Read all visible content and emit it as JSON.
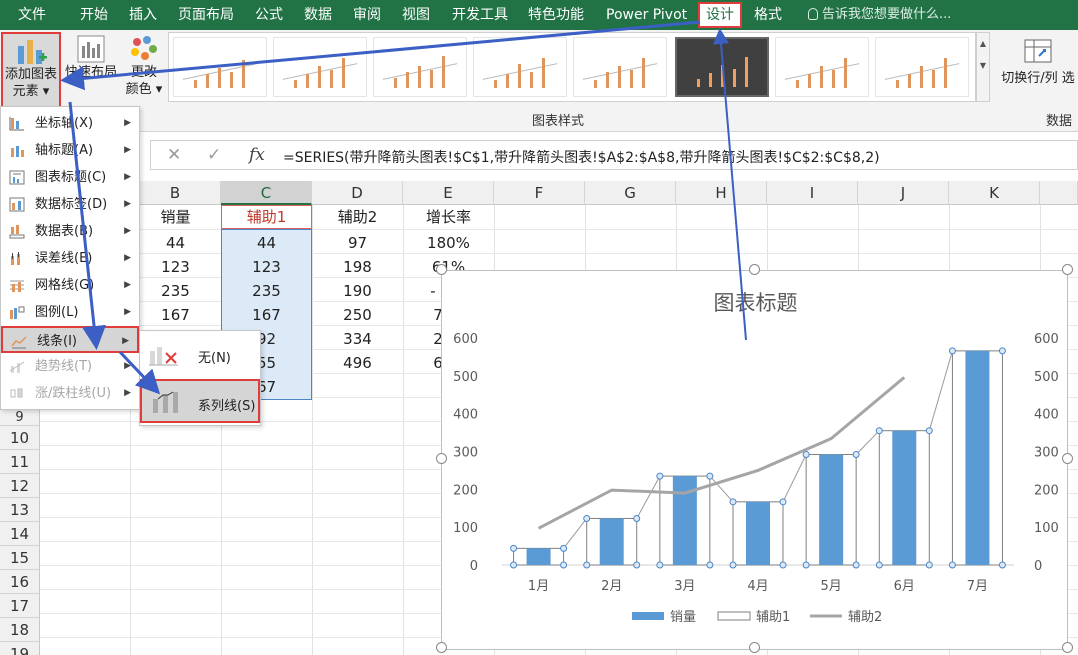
{
  "ribbon_tabs": [
    "文件",
    "开始",
    "插入",
    "页面布局",
    "公式",
    "数据",
    "审阅",
    "视图",
    "开发工具",
    "特色功能",
    "Power Pivot",
    "设计",
    "格式"
  ],
  "tell_me": "告诉我您想要做什么...",
  "ribbon": {
    "add_element_line1": "添加图表",
    "add_element_line2": "元素 ▾",
    "quick_layout": "快速布局",
    "change_color_line1": "更改",
    "change_color_line2": "颜色 ▾",
    "styles_group": "图表样式",
    "switch_row_col": "切换行/列",
    "switch_cut": "选",
    "data_group": "数据"
  },
  "formula_bar": {
    "cancel": "✕",
    "enter": "✓",
    "fx": "fx",
    "formula": "=SERIES(带升降箭头图表!$C$1,带升降箭头图表!$A$2:$A$8,带升降箭头图表!$C$2:$C$8,2)"
  },
  "columns": [
    "B",
    "C",
    "D",
    "E",
    "F",
    "G",
    "H",
    "I",
    "J",
    "K"
  ],
  "rows": [
    "10",
    "11",
    "12",
    "13",
    "14",
    "15",
    "16",
    "17",
    "18",
    "19"
  ],
  "row_nine": "9",
  "table": {
    "headers": [
      "销量",
      "辅助1",
      "辅助2",
      "增长率"
    ],
    "rows": [
      [
        "44",
        "44",
        "97",
        "180%"
      ],
      [
        "123",
        "123",
        "198",
        "61%"
      ],
      [
        "235",
        "235",
        "190",
        "-"
      ],
      [
        "167",
        "167",
        "250",
        "7"
      ],
      [
        "",
        "92",
        "334",
        "2"
      ],
      [
        "",
        "55",
        "496",
        "6"
      ],
      [
        "",
        "67",
        "",
        ""
      ]
    ]
  },
  "menu": {
    "items": [
      {
        "label": "坐标轴(X)",
        "icon": "axis-icon"
      },
      {
        "label": "轴标题(A)",
        "icon": "axis-title-icon"
      },
      {
        "label": "图表标题(C)",
        "icon": "chart-title-icon"
      },
      {
        "label": "数据标签(D)",
        "icon": "data-label-icon"
      },
      {
        "label": "数据表(B)",
        "icon": "data-table-icon"
      },
      {
        "label": "误差线(E)",
        "icon": "error-bar-icon"
      },
      {
        "label": "网格线(G)",
        "icon": "gridline-icon"
      },
      {
        "label": "图例(L)",
        "icon": "legend-icon"
      },
      {
        "label": "线条(I)",
        "icon": "lines-icon"
      },
      {
        "label": "趋势线(T)",
        "icon": "trendline-icon"
      },
      {
        "label": "涨/跌柱线(U)",
        "icon": "updown-bar-icon"
      }
    ],
    "submenu": [
      {
        "label": "无(N)",
        "icon": "none-icon"
      },
      {
        "label": "系列线(S)",
        "icon": "series-line-icon"
      }
    ]
  },
  "chart_data": {
    "type": "bar",
    "title": "图表标题",
    "categories": [
      "1月",
      "2月",
      "3月",
      "4月",
      "5月",
      "6月",
      "7月"
    ],
    "series": [
      {
        "name": "销量",
        "type": "bar",
        "values": [
          44,
          123,
          235,
          167,
          292,
          355,
          566
        ],
        "color": "#5b9bd5"
      },
      {
        "name": "辅助1",
        "type": "bar",
        "values": [
          44,
          123,
          235,
          167,
          292,
          355,
          566
        ],
        "color": "#ffffff"
      },
      {
        "name": "辅助2",
        "type": "line",
        "values": [
          97,
          198,
          190,
          250,
          334,
          496
        ],
        "color": "#a5a5a5"
      }
    ],
    "ylim": [
      0,
      600
    ],
    "yticks": [
      0,
      100,
      200,
      300,
      400,
      500,
      600
    ],
    "secondary_ylim": [
      0,
      600
    ],
    "legend": "bottom",
    "grid": false
  },
  "colors": {
    "ribbon_green": "#217346",
    "highlight_red": "#e03c3c",
    "annotation_blue": "#3b5fc4"
  }
}
